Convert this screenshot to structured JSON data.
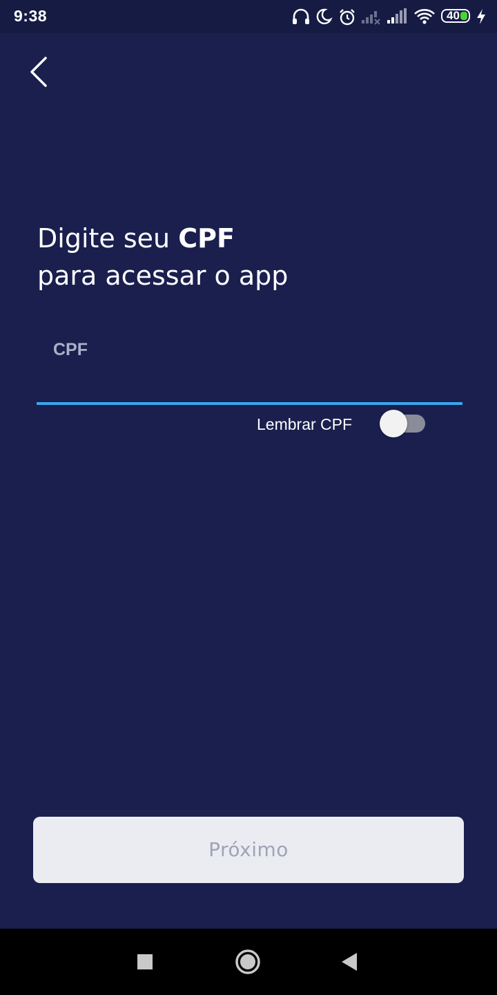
{
  "status_bar": {
    "time": "9:38",
    "battery_level": "40",
    "icons": [
      "headset-icon",
      "moon-icon",
      "alarm-icon",
      "signal-weak-icon",
      "signal-icon",
      "wifi-icon",
      "battery-icon",
      "charging-icon"
    ],
    "battery_color": "#4cd137"
  },
  "header": {
    "back_icon": "chevron-left-icon"
  },
  "headline": {
    "line1_prefix": "Digite seu ",
    "line1_strong": "CPF",
    "line2": "para acessar o app"
  },
  "cpf_field": {
    "label": "CPF",
    "value": "",
    "accent_color": "#3aa7f0"
  },
  "remember": {
    "label": "Lembrar CPF",
    "enabled": false
  },
  "next_button": {
    "label": "Próximo",
    "enabled": false
  },
  "nav_bar": {
    "icons": [
      "recents-square-icon",
      "home-circle-icon",
      "back-triangle-icon"
    ]
  },
  "colors": {
    "background": "#1a1f4e",
    "status_bar": "#161b44",
    "button_bg": "#ebecf1",
    "button_text": "#9fa3b6"
  }
}
